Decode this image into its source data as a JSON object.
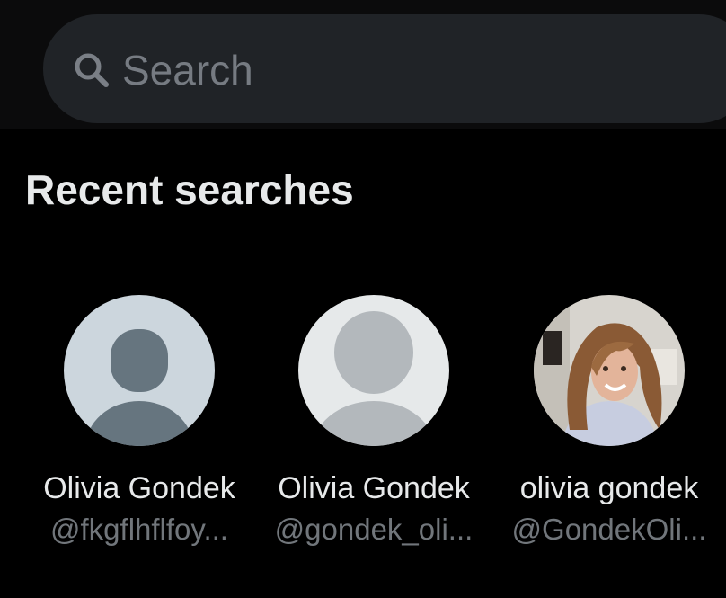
{
  "search": {
    "placeholder": "Search",
    "icon": "search-icon"
  },
  "recent": {
    "title": "Recent searches",
    "items": [
      {
        "name": "Olivia Gondek",
        "handle": "@fkgflhflfoy...",
        "avatar": "default-avatar-dark"
      },
      {
        "name": "Olivia Gondek",
        "handle": "@gondek_oli...",
        "avatar": "default-avatar-light"
      },
      {
        "name": "olivia gondek",
        "handle": "@GondekOli...",
        "avatar": "profile-photo"
      }
    ]
  },
  "colors": {
    "background": "#000000",
    "search_field": "#202327",
    "primary_text": "#e7e9ea",
    "secondary_text": "#71767b"
  }
}
